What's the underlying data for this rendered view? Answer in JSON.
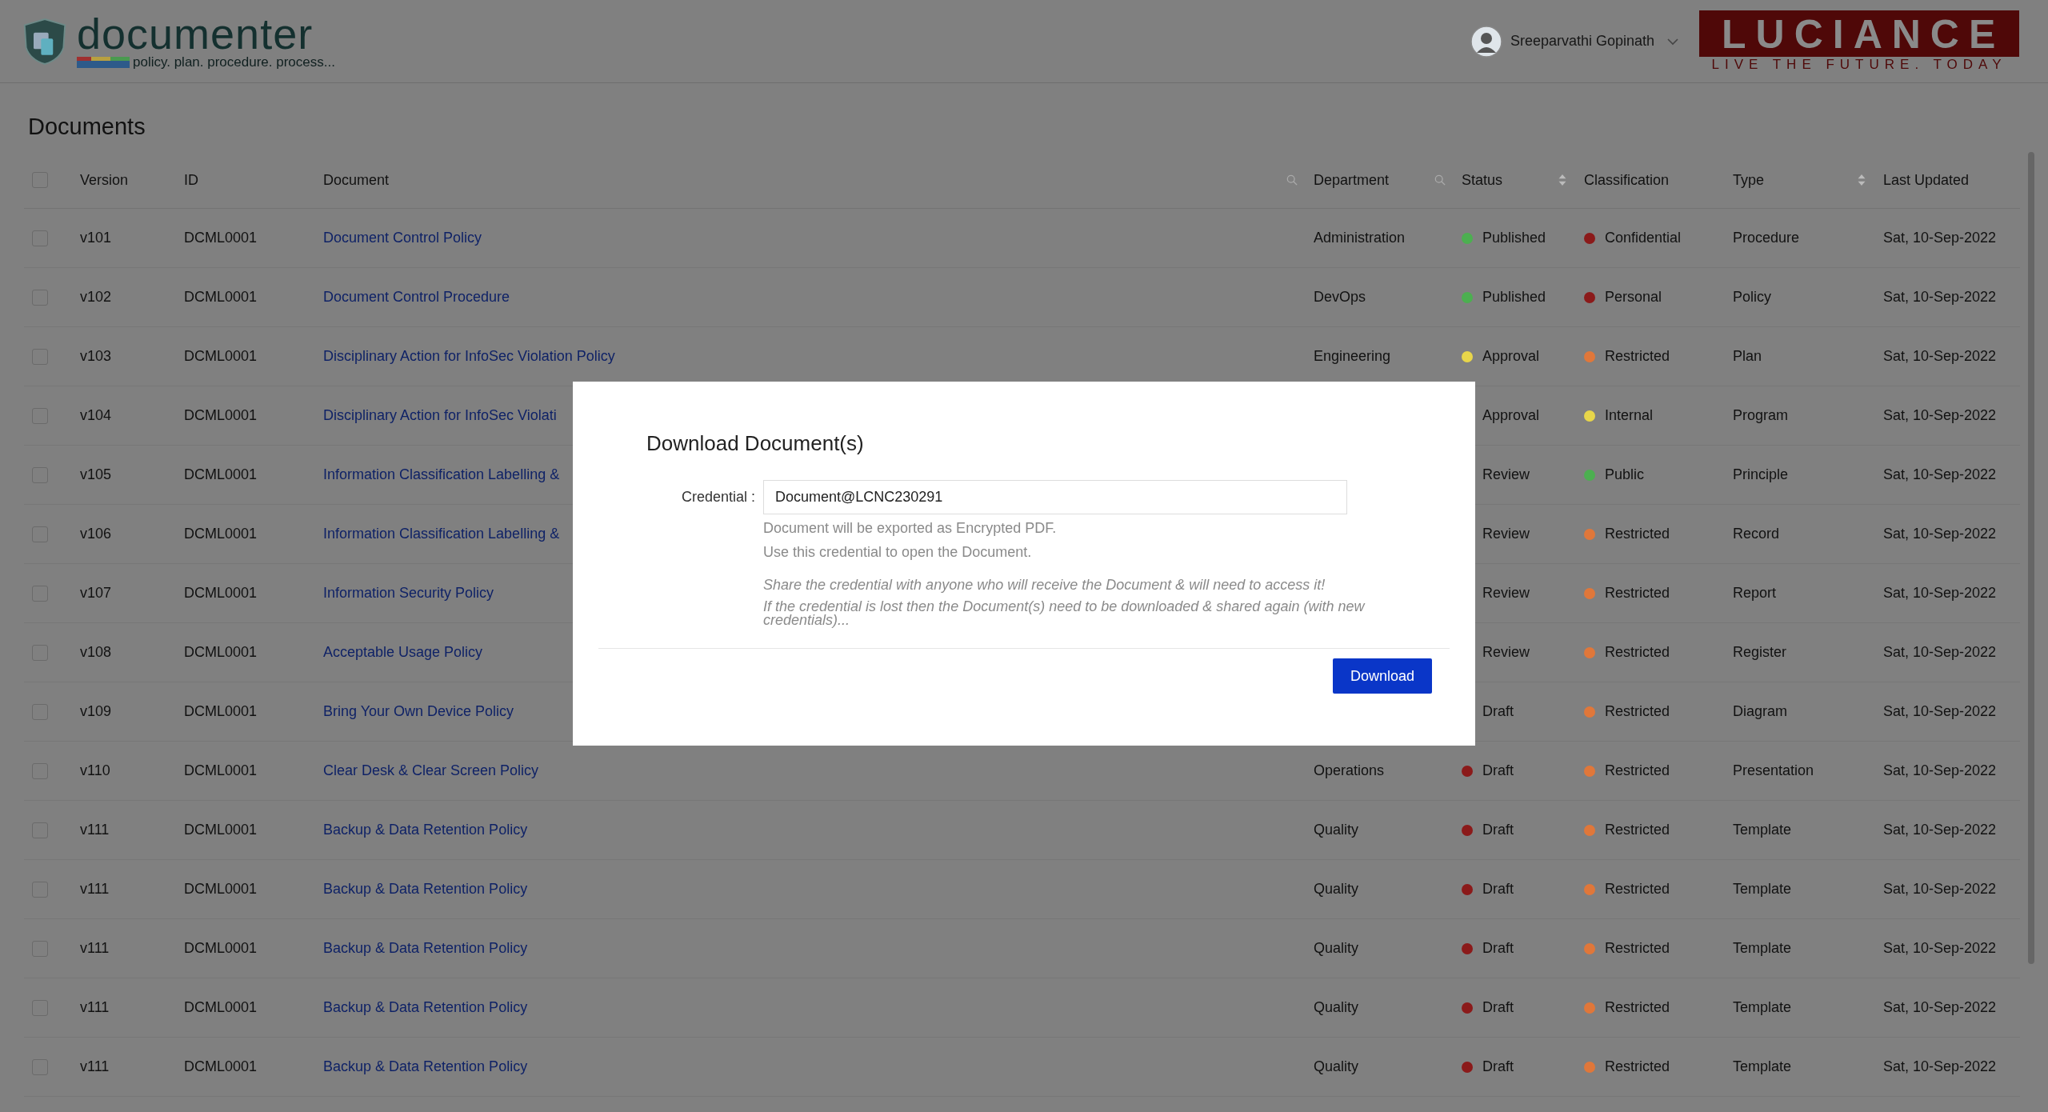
{
  "header": {
    "logo": {
      "name": "documenter",
      "tagline": "policy. plan. procedure. process..."
    },
    "user": {
      "name": "Sreeparvathi Gopinath"
    },
    "brand": {
      "name": "LUCIANCE",
      "tagline": "LIVE THE FUTURE. TODAY"
    }
  },
  "page_title": "Documents",
  "table": {
    "select_all": {
      "checked": false
    },
    "columns": [
      {
        "label": "Version",
        "kind": "plain"
      },
      {
        "label": "ID",
        "kind": "plain"
      },
      {
        "label": "Document",
        "kind": "search"
      },
      {
        "label": "Department",
        "kind": "search"
      },
      {
        "label": "Status",
        "kind": "sort"
      },
      {
        "label": "Classification",
        "kind": "plain"
      },
      {
        "label": "Type",
        "kind": "sort"
      },
      {
        "label": "Last Updated",
        "kind": "plain"
      }
    ],
    "rows": [
      {
        "checked": false,
        "version": "v101",
        "id": "DCML0001",
        "document": "Document Control Policy",
        "department": "Administration",
        "status": {
          "label": "Published",
          "color": "#4caf50"
        },
        "classification": {
          "label": "Confidential",
          "color": "#8b1a1a"
        },
        "type": "Procedure",
        "updated": "Sat, 10-Sep-2022"
      },
      {
        "checked": false,
        "version": "v102",
        "id": "DCML0001",
        "document": "Document Control Procedure",
        "department": "DevOps",
        "status": {
          "label": "Published",
          "color": "#4caf50"
        },
        "classification": {
          "label": "Personal",
          "color": "#8b1a1a"
        },
        "type": "Policy",
        "updated": "Sat, 10-Sep-2022"
      },
      {
        "checked": false,
        "version": "v103",
        "id": "DCML0001",
        "document": "Disciplinary Action for InfoSec Violation Policy",
        "department": "Engineering",
        "status": {
          "label": "Approval",
          "color": "#e8d64a"
        },
        "classification": {
          "label": "Restricted",
          "color": "#e0773a"
        },
        "type": "Plan",
        "updated": "Sat, 10-Sep-2022"
      },
      {
        "checked": false,
        "version": "v104",
        "id": "DCML0001",
        "document": "Disciplinary Action for InfoSec Violati",
        "status": {
          "label": "Approval"
        },
        "classification": {
          "label": "Internal",
          "color": "#e8d64a"
        },
        "type": "Program",
        "updated": "Sat, 10-Sep-2022"
      },
      {
        "checked": false,
        "version": "v105",
        "id": "DCML0001",
        "document": "Information Classification Labelling &",
        "status": {
          "label": "Review"
        },
        "classification": {
          "label": "Public",
          "color": "#4caf50"
        },
        "type": "Principle",
        "updated": "Sat, 10-Sep-2022"
      },
      {
        "checked": false,
        "version": "v106",
        "id": "DCML0001",
        "document": "Information Classification Labelling &",
        "status": {
          "label": "Review"
        },
        "classification": {
          "label": "Restricted",
          "color": "#e0773a"
        },
        "type": "Record",
        "updated": "Sat, 10-Sep-2022"
      },
      {
        "checked": false,
        "version": "v107",
        "id": "DCML0001",
        "document": "Information Security Policy",
        "status": {
          "label": "Review"
        },
        "classification": {
          "label": "Restricted",
          "color": "#e0773a"
        },
        "type": "Report",
        "updated": "Sat, 10-Sep-2022"
      },
      {
        "checked": false,
        "version": "v108",
        "id": "DCML0001",
        "document": "Acceptable Usage Policy",
        "status": {
          "label": "Review"
        },
        "classification": {
          "label": "Restricted",
          "color": "#e0773a"
        },
        "type": "Register",
        "updated": "Sat, 10-Sep-2022"
      },
      {
        "checked": false,
        "version": "v109",
        "id": "DCML0001",
        "document": "Bring Your Own Device Policy",
        "status": {
          "label": "Draft"
        },
        "classification": {
          "label": "Restricted",
          "color": "#e0773a"
        },
        "type": "Diagram",
        "updated": "Sat, 10-Sep-2022"
      },
      {
        "checked": false,
        "version": "v110",
        "id": "DCML0001",
        "document": "Clear Desk & Clear Screen Policy",
        "department": "Operations",
        "status": {
          "label": "Draft",
          "color": "#8b1a1a"
        },
        "classification": {
          "label": "Restricted",
          "color": "#e0773a"
        },
        "type": "Presentation",
        "updated": "Sat, 10-Sep-2022"
      },
      {
        "checked": false,
        "version": "v111",
        "id": "DCML0001",
        "document": "Backup & Data Retention Policy",
        "department": "Quality",
        "status": {
          "label": "Draft",
          "color": "#8b1a1a"
        },
        "classification": {
          "label": "Restricted",
          "color": "#e0773a"
        },
        "type": "Template",
        "updated": "Sat, 10-Sep-2022"
      },
      {
        "checked": false,
        "version": "v111",
        "id": "DCML0001",
        "document": "Backup & Data Retention Policy",
        "department": "Quality",
        "status": {
          "label": "Draft",
          "color": "#8b1a1a"
        },
        "classification": {
          "label": "Restricted",
          "color": "#e0773a"
        },
        "type": "Template",
        "updated": "Sat, 10-Sep-2022"
      },
      {
        "checked": false,
        "version": "v111",
        "id": "DCML0001",
        "document": "Backup & Data Retention Policy",
        "department": "Quality",
        "status": {
          "label": "Draft",
          "color": "#8b1a1a"
        },
        "classification": {
          "label": "Restricted",
          "color": "#e0773a"
        },
        "type": "Template",
        "updated": "Sat, 10-Sep-2022"
      },
      {
        "checked": false,
        "version": "v111",
        "id": "DCML0001",
        "document": "Backup & Data Retention Policy",
        "department": "Quality",
        "status": {
          "label": "Draft",
          "color": "#8b1a1a"
        },
        "classification": {
          "label": "Restricted",
          "color": "#e0773a"
        },
        "type": "Template",
        "updated": "Sat, 10-Sep-2022"
      },
      {
        "checked": false,
        "version": "v111",
        "id": "DCML0001",
        "document": "Backup & Data Retention Policy",
        "department": "Quality",
        "status": {
          "label": "Draft",
          "color": "#8b1a1a"
        },
        "classification": {
          "label": "Restricted",
          "color": "#e0773a"
        },
        "type": "Template",
        "updated": "Sat, 10-Sep-2022"
      }
    ]
  },
  "dialog": {
    "title": "Download Document(s)",
    "field": {
      "label": "Credential :",
      "value": "Document@LCNC230291"
    },
    "notes": [
      {
        "kind": "info",
        "text": "Document will be exported as Encrypted PDF."
      },
      {
        "kind": "info",
        "text": "Use this credential to open the Document."
      },
      {
        "kind": "warning",
        "text": "Share the credential with anyone who will receive the Document & will need to access it!"
      },
      {
        "kind": "warning",
        "text": "If the credential is lost then the Document(s) need to be downloaded & shared again (with new credentials)..."
      }
    ],
    "button": "Download"
  }
}
